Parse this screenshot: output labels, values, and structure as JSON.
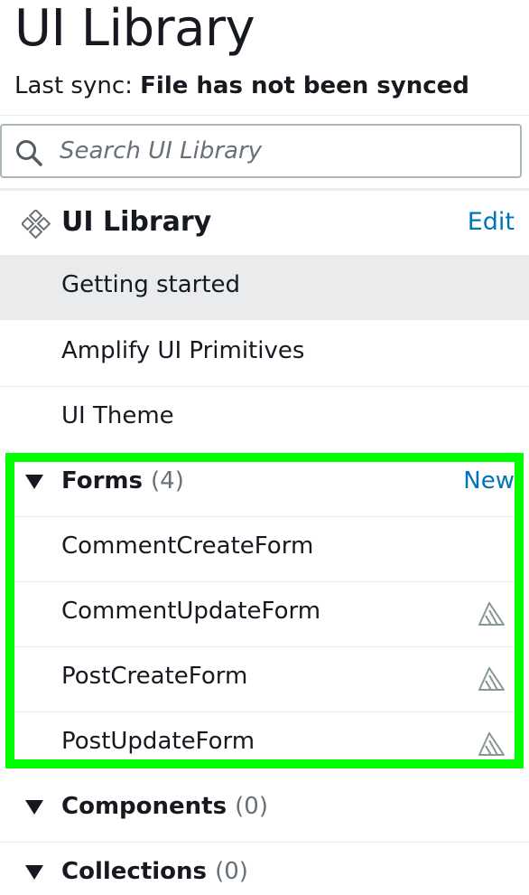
{
  "header": {
    "title": "UI Library",
    "sync_label": "Last sync:",
    "sync_status": "File has not been synced"
  },
  "search": {
    "placeholder": "Search UI Library",
    "value": "",
    "icon": "search-icon"
  },
  "library": {
    "title": "UI Library",
    "icon": "component-cube-icon",
    "edit_label": "Edit",
    "items": [
      {
        "label": "Getting started",
        "selected": true
      },
      {
        "label": "Amplify UI Primitives",
        "selected": false
      },
      {
        "label": "UI Theme",
        "selected": false
      }
    ]
  },
  "forms": {
    "label": "Forms",
    "count": "(4)",
    "new_label": "New",
    "items": [
      {
        "label": "CommentCreateForm",
        "icon": ""
      },
      {
        "label": "CommentUpdateForm",
        "icon": "amplify-icon"
      },
      {
        "label": "PostCreateForm",
        "icon": "amplify-icon"
      },
      {
        "label": "PostUpdateForm",
        "icon": "amplify-icon"
      }
    ]
  },
  "components": {
    "label": "Components",
    "count": "(0)"
  },
  "collections": {
    "label": "Collections",
    "count": "(0)"
  },
  "colors": {
    "link": "#0073bb",
    "highlight": "#00ff00",
    "selected_bg": "#e9ebed"
  }
}
